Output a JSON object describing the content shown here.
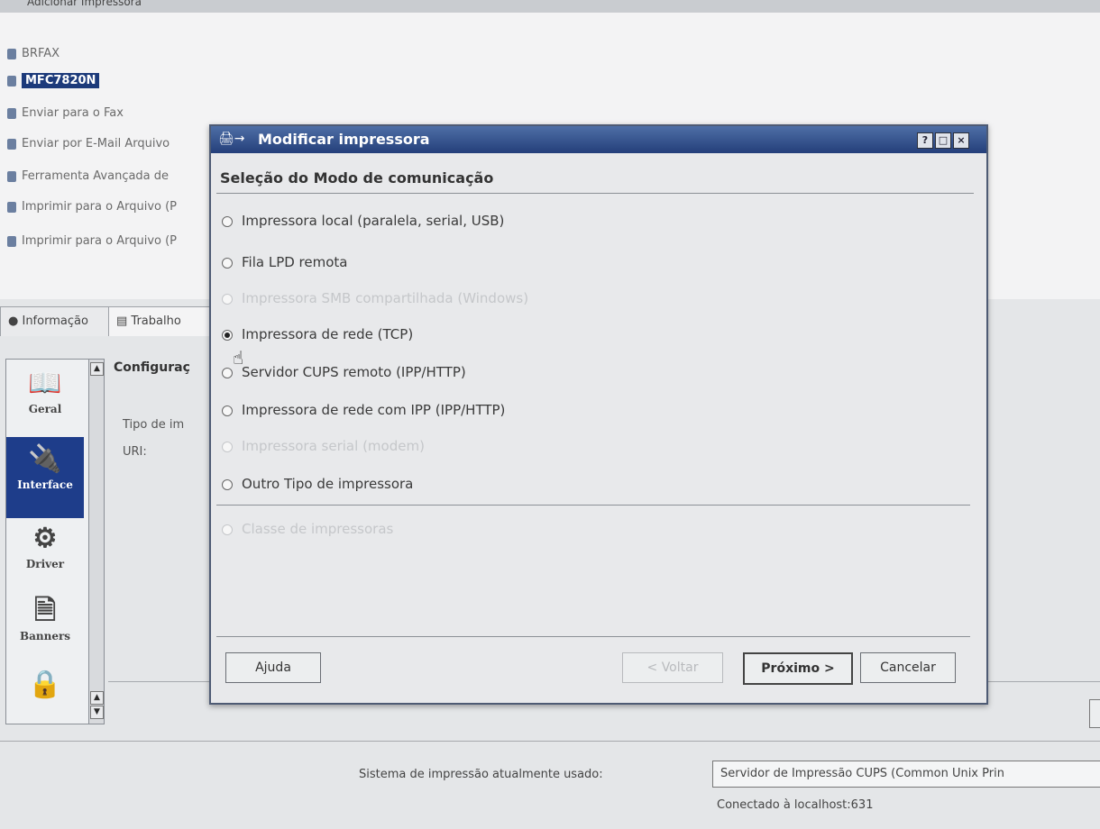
{
  "toolbar": {
    "text": "Adicionar  Impressora"
  },
  "printers": [
    {
      "label": "BRFAX"
    },
    {
      "label": "MFC7820N",
      "selected": true
    },
    {
      "label": "Enviar para o Fax"
    },
    {
      "label": "Enviar por E-Mail Arquivo"
    },
    {
      "label": "Ferramenta Avançada de"
    },
    {
      "label": "Imprimir para o Arquivo (P"
    },
    {
      "label": "Imprimir para o Arquivo (P"
    }
  ],
  "tabs": {
    "info": "Informação",
    "jobs": "Trabalho"
  },
  "sidebar": {
    "items": [
      {
        "label": "Geral",
        "icon": "book-icon"
      },
      {
        "label": "Interface",
        "icon": "plug-icon",
        "active": true
      },
      {
        "label": "Driver",
        "icon": "gear-icon"
      },
      {
        "label": "Banners",
        "icon": "document-icon"
      },
      {
        "label": "",
        "icon": "lock-icon"
      }
    ]
  },
  "config": {
    "title": "Configuraç",
    "type_label": "Tipo de im",
    "uri_label": "URI:"
  },
  "dialog": {
    "title": "Modificar impressora",
    "heading": "Seleção do Modo de comunicação",
    "options": [
      {
        "label": "Impressora local (paralela, serial, USB)",
        "checked": false,
        "disabled": false
      },
      {
        "label": "Fila LPD remota",
        "checked": false,
        "disabled": false
      },
      {
        "label": "Impressora SMB compartilhada (Windows)",
        "checked": false,
        "disabled": true
      },
      {
        "label": "Impressora de rede (TCP)",
        "checked": true,
        "disabled": false
      },
      {
        "label": "Servidor CUPS remoto (IPP/HTTP)",
        "checked": false,
        "disabled": false
      },
      {
        "label": "Impressora de rede com IPP (IPP/HTTP)",
        "checked": false,
        "disabled": false
      },
      {
        "label": "Impressora serial (modem)",
        "checked": false,
        "disabled": true
      },
      {
        "label": "Outro Tipo de impressora",
        "checked": false,
        "disabled": false
      },
      {
        "label": "Classe de impressoras",
        "checked": false,
        "disabled": true
      }
    ],
    "buttons": {
      "help": "Ajuda",
      "back": "< Voltar",
      "next": "Próximo >",
      "cancel": "Cancelar"
    },
    "titlebar_buttons": {
      "help": "?",
      "maximize": "□",
      "close": "×"
    }
  },
  "status": {
    "label": "Sistema de impressão atualmente usado:",
    "value": "Servidor de Impressão CUPS (Common Unix Prin",
    "connected": "Conectado à localhost:631"
  }
}
